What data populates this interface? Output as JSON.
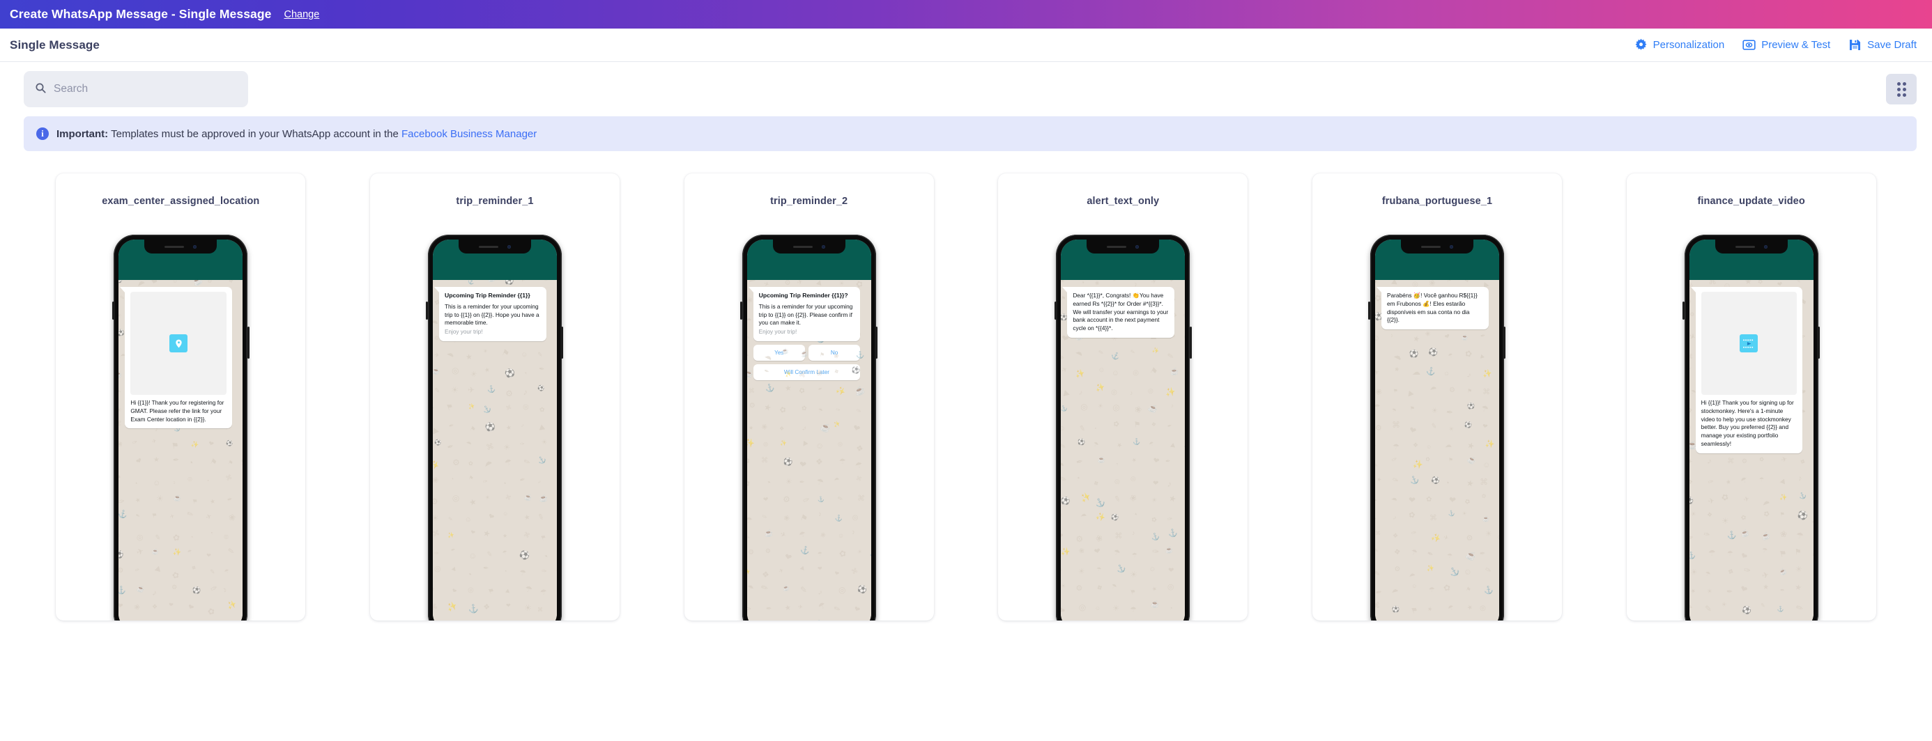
{
  "topbar": {
    "title": "Create WhatsApp Message - Single Message",
    "change_label": "Change",
    "gradient_start": "#4040cf",
    "gradient_end": "#e8448f"
  },
  "subheader": {
    "title": "Single Message",
    "actions": [
      {
        "label": "Personalization",
        "icon": "gear-icon"
      },
      {
        "label": "Preview & Test",
        "icon": "eye-preview-icon"
      },
      {
        "label": "Save Draft",
        "icon": "floppy-save-icon"
      }
    ],
    "accent_color": "#2f7df6"
  },
  "search": {
    "placeholder": "Search",
    "value": "",
    "icon": "search-icon"
  },
  "view_toggle": {
    "icon": "dot-grid-icon"
  },
  "banner": {
    "icon": "info-icon",
    "strong": "Important:",
    "text": " Templates must be approved in your WhatsApp account in the ",
    "link": "Facebook Business Manager",
    "bg": "#e4e8fb",
    "link_color": "#3b6ef5"
  },
  "templates": [
    {
      "name": "exam_center_assigned_location",
      "media": "location-pin-icon",
      "header": "",
      "body": "Hi {{1}}! Thank you for registering for GMAT. Please refer the link for your Exam Center location in {{2}}.",
      "footer": "",
      "buttons": []
    },
    {
      "name": "trip_reminder_1",
      "media": "",
      "header": "Upcoming Trip Reminder {{1}}",
      "body": "This is a reminder for your upcoming trip to {{1}} on {{2}}. Hope you have a memorable time.",
      "footer": "Enjoy your trip!",
      "buttons": []
    },
    {
      "name": "trip_reminder_2",
      "media": "",
      "header": "Upcoming Trip Reminder {{1}}?",
      "body": "This is a reminder for your upcoming trip to {{1}} on {{2}}. Please confirm if you can make it.",
      "footer": "Enjoy your trip!",
      "buttons": [
        "Yes",
        "No",
        "Will Confirm Later"
      ]
    },
    {
      "name": "alert_text_only",
      "media": "",
      "header": "",
      "body": "Dear *{{1}}*, Congrats! 👏You have earned Rs *{{2}}* for Order #*{{3}}*. We will transfer your earnings to your bank account in the next payment cycle on *{{4}}*.",
      "footer": "",
      "buttons": []
    },
    {
      "name": "frubana_portuguese_1",
      "media": "",
      "header": "",
      "body": "Parabéns 🥳! Você ganhou R${{1}} em Frubonos 💰! Eles estarão disponíveis em sua conta no dia {{2}}.",
      "footer": "",
      "buttons": []
    },
    {
      "name": "finance_update_video",
      "media": "video-play-icon",
      "header": "",
      "body": "Hi {{1}}! Thank you for signing up for stockmonkey. Here's a 1-minute video to help you use stockmonkey better. Buy you preferred {{2}} and manage your existing portfolio seamlessly!",
      "footer": "",
      "buttons": []
    }
  ]
}
